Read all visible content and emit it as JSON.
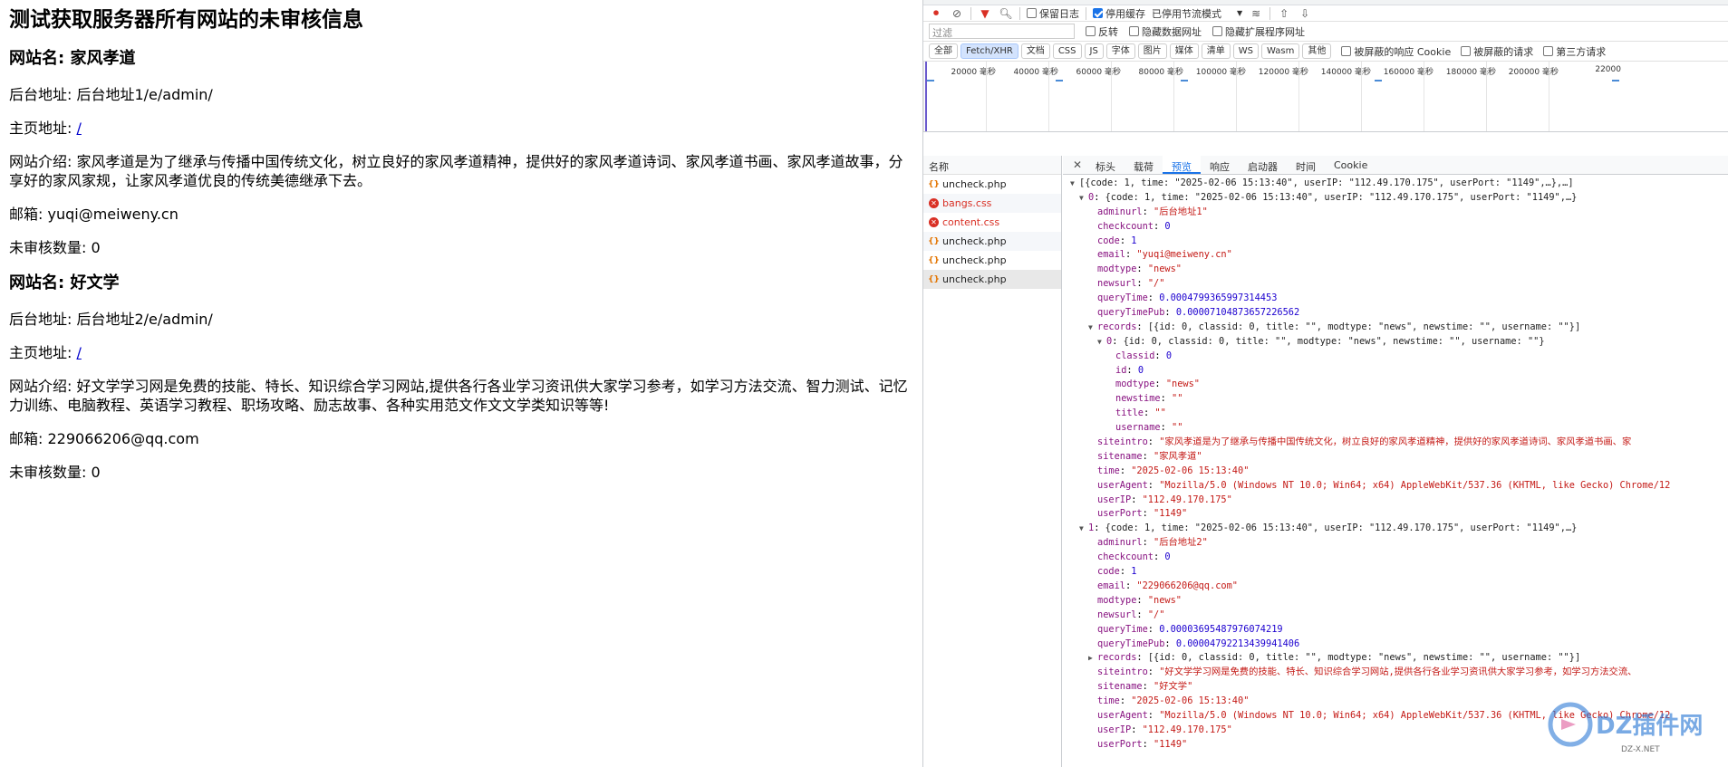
{
  "page": {
    "title": "测试获取服务器所有网站的未审核信息",
    "sites": [
      {
        "name_label": "网站名: 家风孝道",
        "admin": "后台地址: 后台地址1/e/admin/",
        "home_label": "主页地址: ",
        "home_link": "/",
        "intro": "网站介绍: 家风孝道是为了继承与传播中国传统文化，树立良好的家风孝道精神，提供好的家风孝道诗词、家风孝道书画、家风孝道故事，分享好的家风家规，让家风孝道优良的传统美德继承下去。",
        "email": "邮箱: yuqi@meiweny.cn",
        "count": "未审核数量: 0"
      },
      {
        "name_label": "网站名: 好文学",
        "admin": "后台地址: 后台地址2/e/admin/",
        "home_label": "主页地址: ",
        "home_link": "/",
        "intro": "网站介绍: 好文学学习网是免费的技能、特长、知识综合学习网站,提供各行各业学习资讯供大家学习参考，如学习方法交流、智力测试、记忆力训练、电脑教程、英语学习教程、职场攻略、励志故事、各种实用范文作文文学类知识等等!",
        "email": "邮箱: 229066206@qq.com",
        "count": "未审核数量: 0"
      }
    ]
  },
  "devtools": {
    "toolbar": {
      "preserve_log": "保留日志",
      "disable_cache": "停用缓存",
      "throttle": "已停用节流模式"
    },
    "filter": {
      "placeholder": "过滤",
      "invert": "反转",
      "hide_data_urls": "隐藏数据网址",
      "hide_ext_urls": "隐藏扩展程序网址"
    },
    "types": [
      "全部",
      "Fetch/XHR",
      "文档",
      "CSS",
      "JS",
      "字体",
      "图片",
      "媒体",
      "清单",
      "WS",
      "Wasm",
      "其他"
    ],
    "type_selected": "Fetch/XHR",
    "type_checks": {
      "blocked_cookies": "被屏蔽的响应 Cookie",
      "blocked_requests": "被屏蔽的请求",
      "third_party": "第三方请求"
    },
    "timeline_ticks": [
      "20000 毫秒",
      "40000 毫秒",
      "60000 毫秒",
      "80000 毫秒",
      "100000 毫秒",
      "120000 毫秒",
      "140000 毫秒",
      "160000 毫秒",
      "180000 毫秒",
      "200000 毫秒",
      "22000"
    ],
    "names_header": "名称",
    "requests": [
      {
        "name": "uncheck.php",
        "error": false
      },
      {
        "name": "bangs.css",
        "error": true
      },
      {
        "name": "content.css",
        "error": true
      },
      {
        "name": "uncheck.php",
        "error": false
      },
      {
        "name": "uncheck.php",
        "error": false
      },
      {
        "name": "uncheck.php",
        "error": false
      }
    ],
    "detail_tabs": [
      "标头",
      "载荷",
      "预览",
      "响应",
      "启动器",
      "时间",
      "Cookie"
    ],
    "active_tab": "预览",
    "preview_lines": [
      {
        "i": 0,
        "t": "▼",
        "k": "",
        "v": "[{code: 1, time: \"2025-02-06 15:13:40\", userIP: \"112.49.170.175\", userPort: \"1149\",…},…]",
        "c": "g"
      },
      {
        "i": 1,
        "t": "▼",
        "k": "0",
        "v": "{code: 1, time: \"2025-02-06 15:13:40\", userIP: \"112.49.170.175\", userPort: \"1149\",…}",
        "c": "g"
      },
      {
        "i": 2,
        "t": "",
        "k": "adminurl",
        "v": "\"后台地址1\"",
        "c": "s"
      },
      {
        "i": 2,
        "t": "",
        "k": "checkcount",
        "v": "0",
        "c": "n"
      },
      {
        "i": 2,
        "t": "",
        "k": "code",
        "v": "1",
        "c": "n"
      },
      {
        "i": 2,
        "t": "",
        "k": "email",
        "v": "\"yuqi@meiweny.cn\"",
        "c": "s"
      },
      {
        "i": 2,
        "t": "",
        "k": "modtype",
        "v": "\"news\"",
        "c": "s"
      },
      {
        "i": 2,
        "t": "",
        "k": "newsurl",
        "v": "\"/\"",
        "c": "s"
      },
      {
        "i": 2,
        "t": "",
        "k": "queryTime",
        "v": "0.0004799365997314453",
        "c": "n"
      },
      {
        "i": 2,
        "t": "",
        "k": "queryTimePub",
        "v": "0.00007104873657226562",
        "c": "n"
      },
      {
        "i": 2,
        "t": "▼",
        "k": "records",
        "v": "[{id: 0, classid: 0, title: \"\", modtype: \"news\", newstime: \"\", username: \"\"}]",
        "c": "g"
      },
      {
        "i": 3,
        "t": "▼",
        "k": "0",
        "v": "{id: 0, classid: 0, title: \"\", modtype: \"news\", newstime: \"\", username: \"\"}",
        "c": "g"
      },
      {
        "i": 4,
        "t": "",
        "k": "classid",
        "v": "0",
        "c": "n"
      },
      {
        "i": 4,
        "t": "",
        "k": "id",
        "v": "0",
        "c": "n"
      },
      {
        "i": 4,
        "t": "",
        "k": "modtype",
        "v": "\"news\"",
        "c": "s"
      },
      {
        "i": 4,
        "t": "",
        "k": "newstime",
        "v": "\"\"",
        "c": "s"
      },
      {
        "i": 4,
        "t": "",
        "k": "title",
        "v": "\"\"",
        "c": "s"
      },
      {
        "i": 4,
        "t": "",
        "k": "username",
        "v": "\"\"",
        "c": "s"
      },
      {
        "i": 2,
        "t": "",
        "k": "siteintro",
        "v": "\"家风孝道是为了继承与传播中国传统文化，树立良好的家风孝道精神，提供好的家风孝道诗词、家风孝道书画、家",
        "c": "s"
      },
      {
        "i": 2,
        "t": "",
        "k": "sitename",
        "v": "\"家风孝道\"",
        "c": "s"
      },
      {
        "i": 2,
        "t": "",
        "k": "time",
        "v": "\"2025-02-06 15:13:40\"",
        "c": "s"
      },
      {
        "i": 2,
        "t": "",
        "k": "userAgent",
        "v": "\"Mozilla/5.0 (Windows NT 10.0; Win64; x64) AppleWebKit/537.36 (KHTML, like Gecko) Chrome/12",
        "c": "s"
      },
      {
        "i": 2,
        "t": "",
        "k": "userIP",
        "v": "\"112.49.170.175\"",
        "c": "s"
      },
      {
        "i": 2,
        "t": "",
        "k": "userPort",
        "v": "\"1149\"",
        "c": "s"
      },
      {
        "i": 1,
        "t": "▼",
        "k": "1",
        "v": "{code: 1, time: \"2025-02-06 15:13:40\", userIP: \"112.49.170.175\", userPort: \"1149\",…}",
        "c": "g"
      },
      {
        "i": 2,
        "t": "",
        "k": "adminurl",
        "v": "\"后台地址2\"",
        "c": "s"
      },
      {
        "i": 2,
        "t": "",
        "k": "checkcount",
        "v": "0",
        "c": "n"
      },
      {
        "i": 2,
        "t": "",
        "k": "code",
        "v": "1",
        "c": "n"
      },
      {
        "i": 2,
        "t": "",
        "k": "email",
        "v": "\"229066206@qq.com\"",
        "c": "s"
      },
      {
        "i": 2,
        "t": "",
        "k": "modtype",
        "v": "\"news\"",
        "c": "s"
      },
      {
        "i": 2,
        "t": "",
        "k": "newsurl",
        "v": "\"/\"",
        "c": "s"
      },
      {
        "i": 2,
        "t": "",
        "k": "queryTime",
        "v": "0.00003695487976074219",
        "c": "n"
      },
      {
        "i": 2,
        "t": "",
        "k": "queryTimePub",
        "v": "0.000047922134399414​06",
        "c": "n"
      },
      {
        "i": 2,
        "t": "▶",
        "k": "records",
        "v": "[{id: 0, classid: 0, title: \"\", modtype: \"news\", newstime: \"\", username: \"\"}]",
        "c": "g"
      },
      {
        "i": 2,
        "t": "",
        "k": "siteintro",
        "v": "\"好文学学习网是免费的技能、特长、知识综合学习网站,提供各行各业学习资讯供大家学习参考，如学习方法交流、",
        "c": "s"
      },
      {
        "i": 2,
        "t": "",
        "k": "sitename",
        "v": "\"好文学\"",
        "c": "s"
      },
      {
        "i": 2,
        "t": "",
        "k": "time",
        "v": "\"2025-02-06 15:13:40\"",
        "c": "s"
      },
      {
        "i": 2,
        "t": "",
        "k": "userAgent",
        "v": "\"Mozilla/5.0 (Windows NT 10.0; Win64; x64) AppleWebKit/537.36 (KHTML, like Gecko) Chrome/12",
        "c": "s"
      },
      {
        "i": 2,
        "t": "",
        "k": "userIP",
        "v": "\"112.49.170.175\"",
        "c": "s"
      },
      {
        "i": 2,
        "t": "",
        "k": "userPort",
        "v": "\"1149\"",
        "c": "s"
      }
    ],
    "watermark": {
      "brand": "DZ插件网",
      "url": "DZ-X.NET"
    }
  }
}
